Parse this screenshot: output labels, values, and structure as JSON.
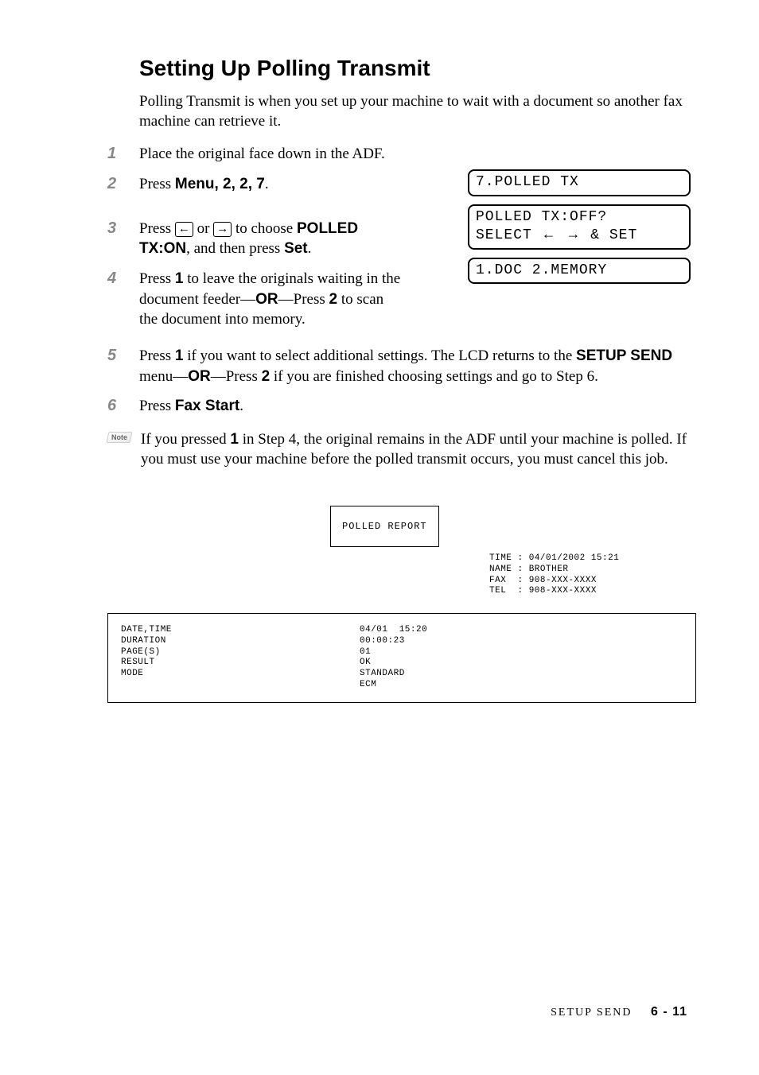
{
  "heading": "Setting Up Polling Transmit",
  "intro": "Polling Transmit is when you set up your machine to wait with a document so another fax machine can retrieve it.",
  "steps": {
    "s1_num": "1",
    "s1_text": "Place the original face down in the ADF.",
    "s2_num": "2",
    "s2_press": "Press ",
    "s2_menu": "Menu",
    "s2_seq": ", 2, 2, 7",
    "s2_dot": ".",
    "s3_num": "3",
    "s3_press": "Press ",
    "s3_or": " or ",
    "s3_choose": " to choose ",
    "s3_opt": "POLLED TX:ON",
    "s3_thenpress": ", and then press ",
    "s3_set": "Set",
    "s4_num": "4",
    "s4_a": "Press ",
    "s4_k1": "1",
    "s4_b": " to leave the originals waiting in the document feeder—",
    "s4_or": "OR",
    "s4_c": "—Press ",
    "s4_k2": "2",
    "s4_d": " to scan the document into memory.",
    "s5_num": "5",
    "s5_a": "Press ",
    "s5_k1": "1",
    "s5_b": " if you want to select additional settings. The LCD returns to the ",
    "s5_menu": "SETUP SEND",
    "s5_c": " menu—",
    "s5_or": "OR",
    "s5_d": "—Press ",
    "s5_k2": "2",
    "s5_e": " if you are finished choosing settings and go to Step 6.",
    "s6_num": "6",
    "s6_press": "Press ",
    "s6_btn": "Fax Start",
    "s6_dot": "."
  },
  "lcd": {
    "l1": "7.POLLED TX",
    "l2a": "POLLED TX:OFF?",
    "l2b_prefix": "SELECT ",
    "l2b_suffix": " & SET",
    "l3": "1.DOC 2.MEMORY"
  },
  "note": {
    "badge": "Note",
    "a": "If you pressed ",
    "k": "1",
    "b": " in Step 4, the original remains in the ADF until your machine is polled.  If you must use your machine before the polled transmit occurs, you must cancel this job."
  },
  "report": {
    "title": "POLLED REPORT",
    "meta": "TIME : 04/01/2002 15:21\nNAME : BROTHER\nFAX  : 908-XXX-XXXX\nTEL  : 908-XXX-XXXX",
    "col1": "DATE,TIME\nDURATION\nPAGE(S)\nRESULT\nMODE",
    "col2": "04/01  15:20\n00:00:23\n01\nOK\nSTANDARD\nECM"
  },
  "footer": {
    "section": "SETUP SEND",
    "page": "6 - 11"
  }
}
